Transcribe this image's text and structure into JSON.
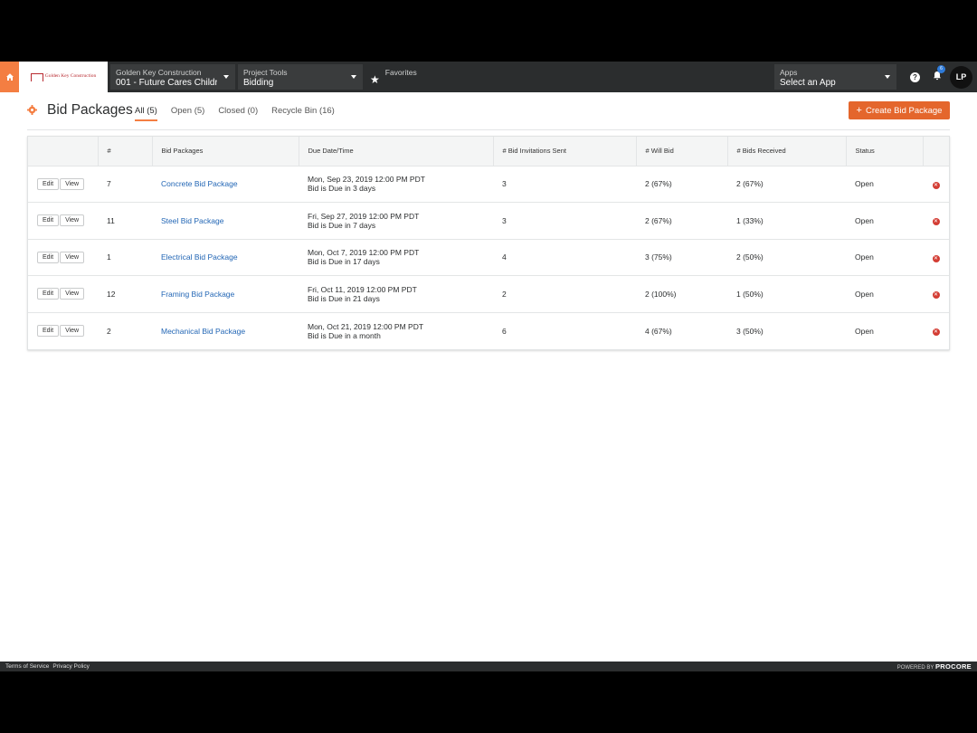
{
  "topbar": {
    "company_label": "Golden Key Construction",
    "project_value": "001 - Future Cares Childr...",
    "tools_label": "Project Tools",
    "tools_value": "Bidding",
    "favorites_label": "Favorites",
    "apps_label": "Apps",
    "apps_value": "Select an App",
    "logo_text": "Golden Key Construction",
    "notification_count": "6",
    "avatar_initials": "LP",
    "accent_color": "#f47e42"
  },
  "header": {
    "title": "Bid Packages",
    "tabs": [
      {
        "label": "All (5)"
      },
      {
        "label": "Open (5)"
      },
      {
        "label": "Closed (0)"
      },
      {
        "label": "Recycle Bin (16)"
      }
    ],
    "create_label": "Create Bid Package"
  },
  "table": {
    "columns": [
      "#",
      "Bid Packages",
      "Due Date/Time",
      "# Bid Invitations Sent",
      "# Will Bid",
      "# Bids Received",
      "Status"
    ],
    "edit_label": "Edit",
    "view_label": "View",
    "rows": [
      {
        "num": "7",
        "name": "Concrete Bid Package",
        "due_date": "Mon, Sep 23, 2019 12:00 PM PDT",
        "due_note": "Bid is Due in 3 days",
        "invitations": "3",
        "will_bid": "2 (67%)",
        "received": "2 (67%)",
        "status": "Open"
      },
      {
        "num": "11",
        "name": "Steel Bid Package",
        "due_date": "Fri, Sep 27, 2019 12:00 PM PDT",
        "due_note": "Bid is Due in 7 days",
        "invitations": "3",
        "will_bid": "2 (67%)",
        "received": "1 (33%)",
        "status": "Open"
      },
      {
        "num": "1",
        "name": "Electrical Bid Package",
        "due_date": "Mon, Oct 7, 2019 12:00 PM PDT",
        "due_note": "Bid is Due in 17 days",
        "invitations": "4",
        "will_bid": "3 (75%)",
        "received": "2 (50%)",
        "status": "Open"
      },
      {
        "num": "12",
        "name": "Framing Bid Package",
        "due_date": "Fri, Oct 11, 2019 12:00 PM PDT",
        "due_note": "Bid is Due in 21 days",
        "invitations": "2",
        "will_bid": "2 (100%)",
        "received": "1 (50%)",
        "status": "Open"
      },
      {
        "num": "2",
        "name": "Mechanical Bid Package",
        "due_date": "Mon, Oct 21, 2019 12:00 PM PDT",
        "due_note": "Bid is Due in a month",
        "invitations": "6",
        "will_bid": "4 (67%)",
        "received": "3 (50%)",
        "status": "Open"
      }
    ]
  },
  "footer": {
    "terms": "Terms of Service",
    "privacy": "Privacy Policy",
    "powered_by": "POWERED BY",
    "brand": "PROCORE"
  }
}
